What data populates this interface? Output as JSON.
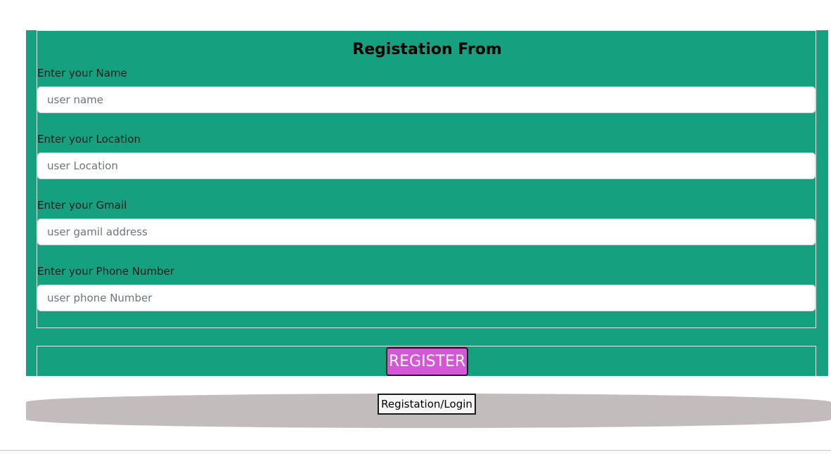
{
  "form": {
    "title": "Registation From",
    "fields": [
      {
        "label": "Enter your Name",
        "placeholder": "user name",
        "value": ""
      },
      {
        "label": "Enter your Location",
        "placeholder": "user Location",
        "value": ""
      },
      {
        "label": "Enter your Gmail",
        "placeholder": "user gamil address",
        "value": ""
      },
      {
        "label": "Enter your Phone Number",
        "placeholder": "user phone Number",
        "value": ""
      }
    ],
    "submit_label": "REGISTER"
  },
  "footer": {
    "switch_label": "Registation/Login"
  },
  "colors": {
    "panel": "#15a080",
    "register_button": "#d357d6",
    "footer_bar": "#c2bcbc"
  }
}
